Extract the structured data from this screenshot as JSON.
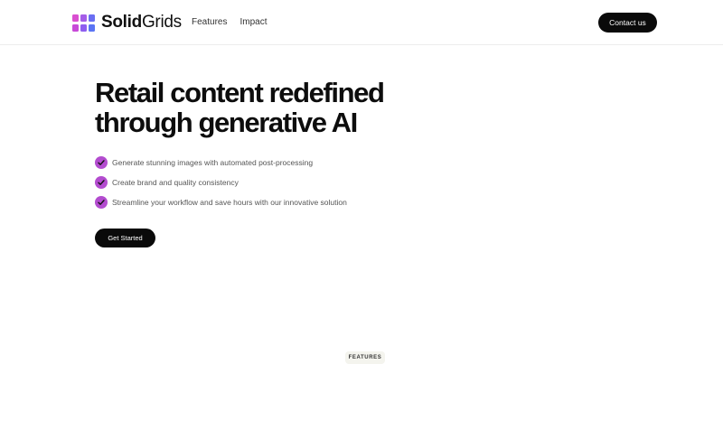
{
  "header": {
    "logo": {
      "bold": "Solid",
      "regular": "Grids"
    },
    "nav": [
      "Features",
      "Impact"
    ],
    "contact_label": "Contact us"
  },
  "hero": {
    "title": "Retail content redefined through generative AI",
    "features": [
      "Generate stunning images with automated post-processing",
      "Create brand and quality consistency",
      "Streamline your workflow and save hours with our innovative solution"
    ],
    "cta_label": "Get Started",
    "check_color": "#b34ccf"
  },
  "section": {
    "badge": "FEATURES"
  },
  "colors": {
    "logo_gradient": [
      "#d94fd0",
      "#a45de8",
      "#6a6ef2"
    ],
    "button_bg": "#0a0a0a",
    "background": "#ffffff"
  },
  "icons": {
    "logo": "grid-logo-icon",
    "check": "check-circle-icon"
  }
}
